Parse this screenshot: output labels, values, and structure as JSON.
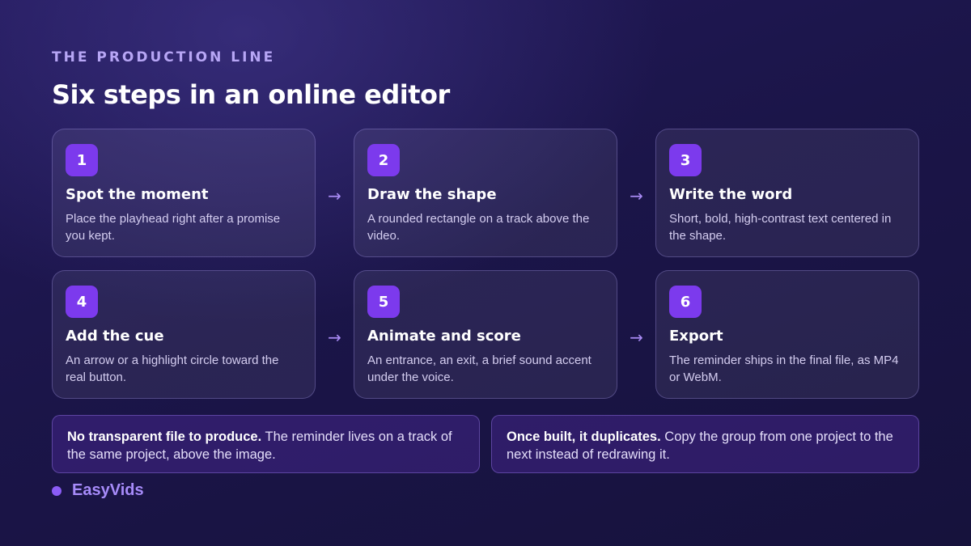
{
  "header": {
    "eyebrow": "THE PRODUCTION LINE",
    "title": "Six steps in an online editor"
  },
  "steps": [
    {
      "number": "1",
      "title": "Spot the moment",
      "desc": "Place the playhead right after a promise you kept."
    },
    {
      "number": "2",
      "title": "Draw the shape",
      "desc": "A rounded rectangle on a track above the video."
    },
    {
      "number": "3",
      "title": "Write the word",
      "desc": "Short, bold, high-contrast text centered in the shape."
    },
    {
      "number": "4",
      "title": "Add the cue",
      "desc": "An arrow or a highlight circle toward the real button."
    },
    {
      "number": "5",
      "title": "Animate and score",
      "desc": "An entrance, an exit, a brief sound accent under the voice."
    },
    {
      "number": "6",
      "title": "Export",
      "desc": "The reminder ships in the final file, as MP4 or WebM."
    }
  ],
  "arrow_glyph": "→",
  "notes": [
    {
      "bold": "No transparent file to produce.",
      "text": " The reminder lives on a track of the same project, above the image."
    },
    {
      "bold": "Once built, it duplicates.",
      "text": " Copy the group from one project to the next instead of redrawing it."
    }
  ],
  "brand": {
    "name": "EasyVids"
  },
  "colors": {
    "accent": "#7c3aed",
    "eyebrow": "#b7a6f5",
    "brand": "#a78bfa",
    "background": "#1b1549"
  }
}
